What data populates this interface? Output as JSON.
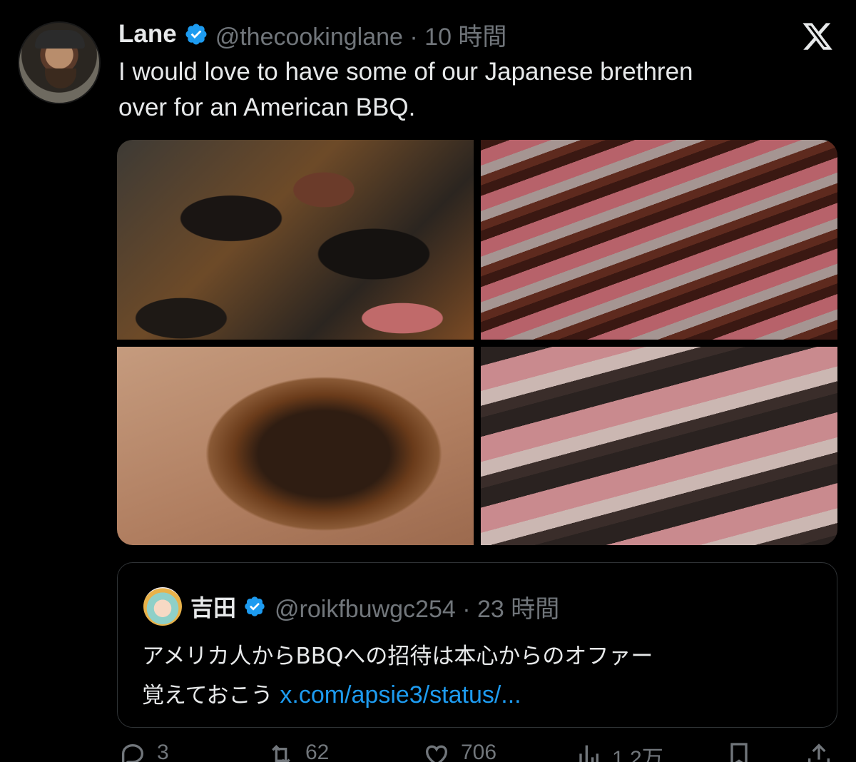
{
  "tweet": {
    "author_name": "Lane",
    "handle_time": "@thecookinglane · 10 時間",
    "text": "I would love to have some of our Japanese brethren\nover for an American BBQ."
  },
  "media": {
    "photos": [
      "bbq-ribs-brisket-tray",
      "sliced-brisket",
      "pork-shoulder",
      "brisket-slices-closeup"
    ]
  },
  "quoted_tweet": {
    "author_name": "吉田",
    "handle_time": "@roikfbuwgc254 · 23 時間",
    "text_line1": "アメリカ人からBBQへの招待は本心からのオファー",
    "text_line2": "覚えておこう ",
    "link": "x.com/apsie3/status/..."
  },
  "actions": {
    "replies": "3",
    "reposts": "62",
    "likes": "706",
    "views": "1.2万"
  },
  "colors": {
    "background": "#000000",
    "text": "#e7e9ea",
    "secondary": "#71767b",
    "link": "#1d9bf0",
    "verified": "#1d9bf0"
  }
}
